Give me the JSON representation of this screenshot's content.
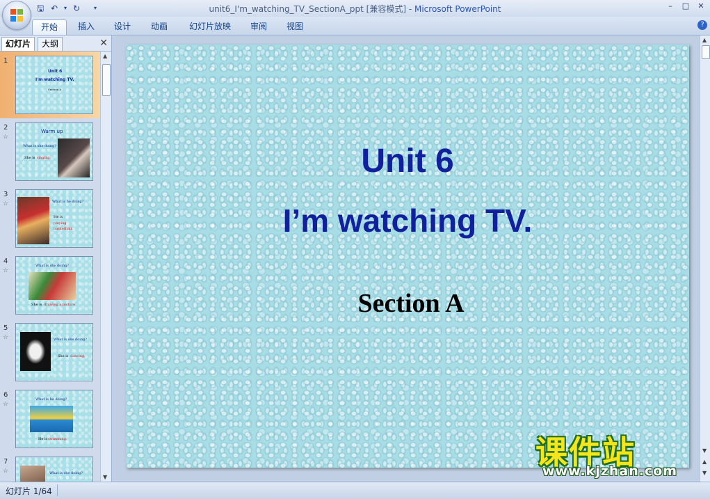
{
  "window": {
    "title_doc": "unit6_I'm_watching_TV_SectionA_ppt [兼容模式]",
    "title_sep": " - ",
    "title_app": "Microsoft PowerPoint"
  },
  "ribbon": {
    "tabs": [
      "开始",
      "插入",
      "设计",
      "动画",
      "幻灯片放映",
      "审阅",
      "视图"
    ],
    "help": "?"
  },
  "panel": {
    "tabs": [
      "幻灯片",
      "大纲"
    ],
    "close": "✕"
  },
  "thumbnails": [
    {
      "num": "1",
      "lines": [
        "Unit 6",
        "I'm watching TV.",
        "Section A"
      ]
    },
    {
      "num": "2",
      "heading": "Warm up",
      "question": "What is she doing?",
      "answer_prefix": "She is",
      "answer": "singing."
    },
    {
      "num": "3",
      "question": "What is he doing?",
      "answer_prefix": "He is",
      "answer": "playing basketball."
    },
    {
      "num": "4",
      "question": "What is she doing?",
      "answer_prefix": "She is",
      "answer": "drawing a picture."
    },
    {
      "num": "5",
      "question": "What is she doing?",
      "answer_prefix": "She is",
      "answer": "dancing."
    },
    {
      "num": "6",
      "question": "What is he doing?",
      "answer_prefix": "He is",
      "answer": "swimming."
    },
    {
      "num": "7",
      "question": "What is she doing?"
    }
  ],
  "slide": {
    "unit": "Unit 6",
    "subtitle": "I’m watching TV.",
    "section": "Section A"
  },
  "watermark": {
    "cn": "课件站",
    "url": "www.kjzhan.com"
  },
  "status": {
    "slide_info": "幻灯片 1/64"
  },
  "colors": {
    "slide_title": "#11209c",
    "slide_bg": "#a8dde6",
    "selected_thumb": "#f0b070"
  }
}
